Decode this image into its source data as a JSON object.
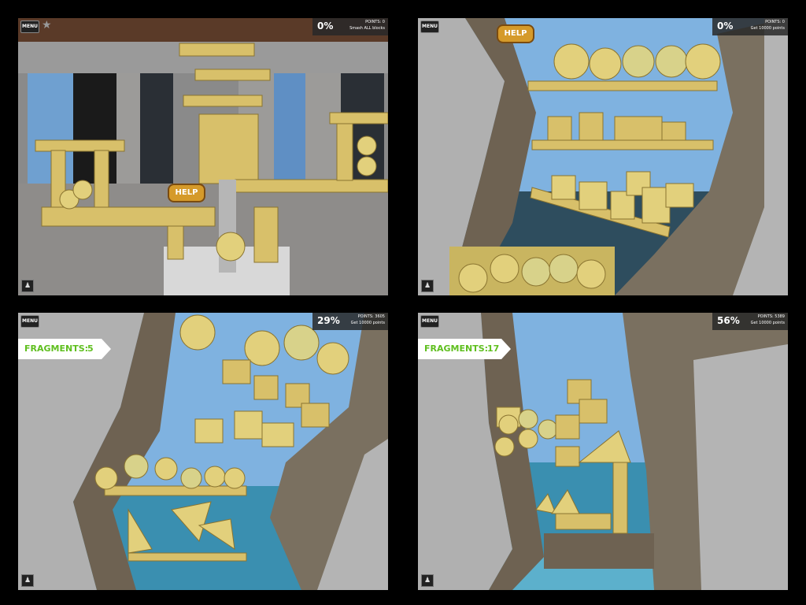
{
  "panels": [
    {
      "menu_label": "MENU",
      "star_icon": "★",
      "percent": "0%",
      "points": "POINTS: 0",
      "goal": "Smash ALL blocks",
      "help_label": "HELP",
      "user_icon": "user-icon"
    },
    {
      "menu_label": "MENU",
      "percent": "0%",
      "points": "POINTS: 0",
      "goal": "Get 10000 points",
      "help_label": "HELP",
      "user_icon": "user-icon"
    },
    {
      "menu_label": "MENU",
      "percent": "29%",
      "points": "POINTS: 3605",
      "goal": "Get 10000 points",
      "fragments_label": "FRAGMENTS:",
      "fragments_count": "5",
      "user_icon": "user-icon"
    },
    {
      "menu_label": "MENU",
      "percent": "56%",
      "points": "POINTS: 5389",
      "goal": "Get 10000 points",
      "fragments_label": "FRAGMENTS:",
      "fragments_count": "17",
      "user_icon": "user-icon"
    }
  ],
  "colors": {
    "wood": "#d8c06a",
    "wood_dark": "#8a7430",
    "stone": "#a9a9a9",
    "sky": "#7fb2e0",
    "water": "#3a8fb0",
    "frag_green": "#5fbf1f"
  }
}
